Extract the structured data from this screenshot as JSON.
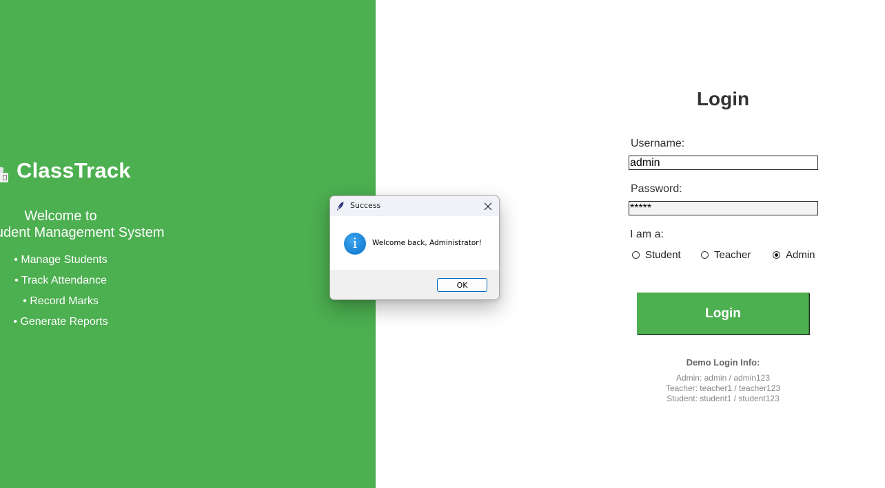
{
  "brand": {
    "title": "ClassTrack",
    "icon": "school-icon",
    "welcome_line1": "Welcome to",
    "welcome_line2": "Student Management System",
    "features": [
      "• Manage Students",
      "• Track Attendance",
      "• Record Marks",
      "• Generate Reports"
    ],
    "panel_color": "#4caf50"
  },
  "login": {
    "heading": "Login",
    "username_label": "Username:",
    "username_value": "admin",
    "password_label": "Password:",
    "password_value": "*****",
    "role_label": "I am a:",
    "roles": [
      {
        "label": "Student",
        "selected": false
      },
      {
        "label": "Teacher",
        "selected": false
      },
      {
        "label": "Admin",
        "selected": true
      }
    ],
    "button_label": "Login",
    "button_color": "#4caf50"
  },
  "demo": {
    "title": "Demo Login Info:",
    "lines": [
      "Admin: admin / admin123",
      "Teacher: teacher1 / teacher123",
      "Student: student1 / student123"
    ]
  },
  "dialog": {
    "title": "Success",
    "title_icon": "feather-icon",
    "message_icon": "info-icon",
    "message": "Welcome back, Administrator!",
    "ok_label": "OK",
    "accent_color": "#0067c0"
  }
}
